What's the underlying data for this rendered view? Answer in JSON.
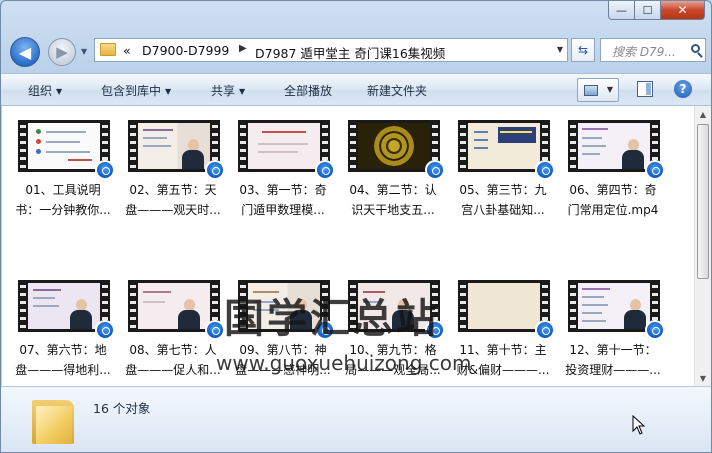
{
  "window": {
    "caption_buttons": {
      "minimize": "—",
      "maximize": "☐",
      "close": "✕"
    }
  },
  "address": {
    "overflow": "«",
    "crumbs": [
      "D7900-D7999",
      "D7987 遁甲堂主 奇门课16集视频"
    ]
  },
  "search": {
    "placeholder": "搜索 D79..."
  },
  "toolbar": {
    "organize": "组织",
    "include_in_library": "包含到库中",
    "share": "共享",
    "play_all": "全部播放",
    "new_folder": "新建文件夹"
  },
  "items": [
    {
      "line1": "01、工具说明",
      "line2": "书：一分钟教你...",
      "scene": "white"
    },
    {
      "line1": "02、第五节：天",
      "line2": "盘———观天时...",
      "scene": "slide"
    },
    {
      "line1": "03、第一节：奇",
      "line2": "门遁甲数理模...",
      "scene": "pink"
    },
    {
      "line1": "04、第二节：认",
      "line2": "识天干地支五...",
      "scene": "gold"
    },
    {
      "line1": "05、第三节：九",
      "line2": "宫八卦基础知...",
      "scene": "paper"
    },
    {
      "line1": "06、第四节：奇",
      "line2": "门常用定位.mp4",
      "scene": "purple"
    },
    {
      "line1": "07、第六节：地",
      "line2": "盘———得地利...",
      "scene": "slide"
    },
    {
      "line1": "08、第七节：人",
      "line2": "盘———促人和...",
      "scene": "pink"
    },
    {
      "line1": "09、第八节：神",
      "line2": "盘———感神明...",
      "scene": "slide"
    },
    {
      "line1": "10、第九节：格",
      "line2": "局———观全局...",
      "scene": "slide"
    },
    {
      "line1": "11、第十节：主",
      "line2": "财&偏财———...",
      "scene": "paper"
    },
    {
      "line1": "12、第十一节：",
      "line2": "投资理财———...",
      "scene": "purple"
    }
  ],
  "watermark": {
    "chinese": "国学汇总站",
    "url": "www.guoxuehuizong.com"
  },
  "details": {
    "count": "16 个对象"
  },
  "icons": {
    "back": "arrow-left-icon",
    "forward": "arrow-right-icon",
    "refresh": "refresh-icon",
    "search": "search-icon",
    "help": "help-icon"
  }
}
